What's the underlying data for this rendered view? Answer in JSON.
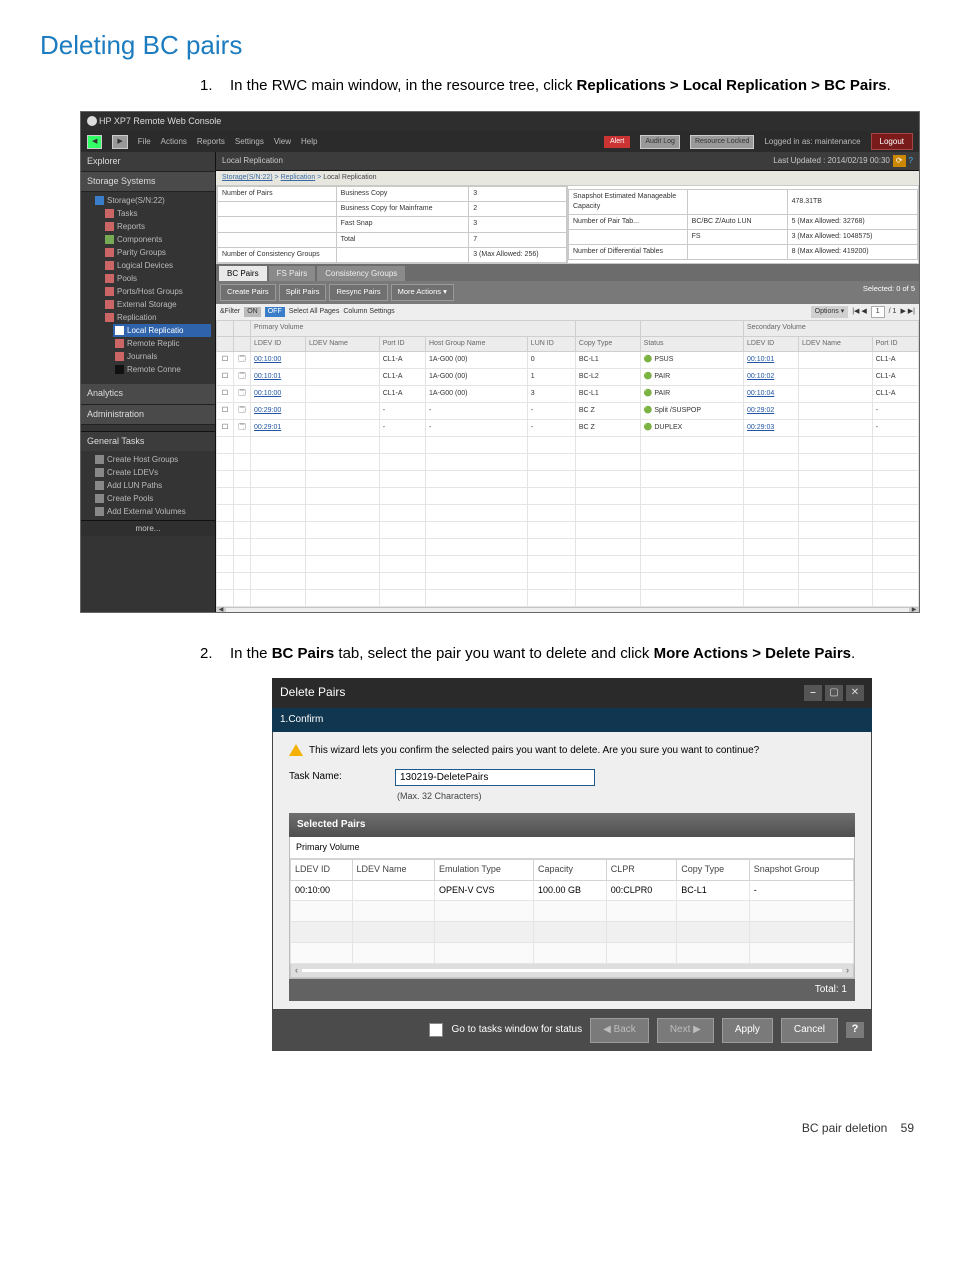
{
  "heading": "Deleting BC pairs",
  "steps": {
    "s1_pre": "In the RWC main window, in the resource tree, click ",
    "s1_strong": "Replications > Local Replication > BC Pairs",
    "s1_post": ".",
    "s2_pre": "In the ",
    "s2_strong1": "BC Pairs",
    "s2_mid": " tab, select the pair you want to delete and click ",
    "s2_strong2": "More Actions > Delete Pairs",
    "s2_post": "."
  },
  "s1": {
    "title": "HP XP7 Remote Web Console",
    "menu": [
      "File",
      "Actions",
      "Reports",
      "Settings",
      "View",
      "Help"
    ],
    "alert": "Alert",
    "auditbtn": [
      "Audit Log",
      "Resource Locked"
    ],
    "loggedin": "Logged in as: maintenance",
    "logout": "Logout",
    "explorer": "Explorer",
    "storage": "Storage Systems",
    "right_title": "Local Replication",
    "updated": "Last Updated : 2014/02/19 00:30",
    "tree": [
      {
        "lbl": "Storage(S/N:22)",
        "cls": "i1",
        "ic": "#3a7dc9"
      },
      {
        "lbl": "Tasks",
        "cls": "i2",
        "ic": "#c66"
      },
      {
        "lbl": "Reports",
        "cls": "i2",
        "ic": "#c66"
      },
      {
        "lbl": "Components",
        "cls": "i2",
        "ic": "#7a5"
      },
      {
        "lbl": "Parity Groups",
        "cls": "i2",
        "ic": "#c66"
      },
      {
        "lbl": "Logical Devices",
        "cls": "i2",
        "ic": "#c66"
      },
      {
        "lbl": "Pools",
        "cls": "i2",
        "ic": "#c66"
      },
      {
        "lbl": "Ports/Host Groups",
        "cls": "i2",
        "ic": "#c66"
      },
      {
        "lbl": "External Storage",
        "cls": "i2",
        "ic": "#c66"
      },
      {
        "lbl": "Replication",
        "cls": "i2",
        "ic": "#c66"
      },
      {
        "lbl": "Local Replicatio",
        "cls": "i3 sel",
        "ic": "#fff"
      },
      {
        "lbl": "Remote Replic",
        "cls": "i3",
        "ic": "#c66"
      },
      {
        "lbl": "Journals",
        "cls": "i3",
        "ic": "#c66"
      },
      {
        "lbl": "Remote Conne",
        "cls": "i3",
        "ic": "#111"
      }
    ],
    "sections": [
      "Analytics",
      "Administration"
    ],
    "crumb": [
      "Storage(S/N:22)",
      "Replication",
      "Local Replication"
    ],
    "summary_left": [
      [
        "Number of Pairs",
        "Business Copy",
        "3"
      ],
      [
        "",
        "Business Copy for Mainframe",
        "2"
      ],
      [
        "",
        "Fast Snap",
        "3"
      ],
      [
        "",
        "Total",
        "7"
      ],
      [
        "Number of Consistency Groups",
        "",
        "3 (Max Allowed: 256)"
      ]
    ],
    "summary_right": [
      [
        "Snapshot Estimated Manageable Capacity",
        "",
        "478.31TB"
      ],
      [
        "Number of Pair Tab...",
        "BC/BC Z/Auto LUN",
        "5 (Max Allowed: 32768)"
      ],
      [
        "",
        "FS",
        "3 (Max Allowed: 1048575)"
      ],
      [
        "Number of Differential Tables",
        "",
        "8 (Max Allowed: 419200)"
      ]
    ],
    "tabs": [
      "BC Pairs",
      "FS Pairs",
      "Consistency Groups"
    ],
    "toolbar": [
      "Create Pairs",
      "Split Pairs",
      "Resync Pairs",
      "More Actions"
    ],
    "selected": "Selected: 0  of 5",
    "filter": [
      "&Filter",
      "ON",
      "OFF",
      "Select All Pages",
      "Column Settings"
    ],
    "options": "Options",
    "page": "1",
    "pagetot": "/ 1",
    "cols1": [
      "",
      "",
      "LDEV ID",
      "LDEV Name",
      "Port ID",
      "Host Group Name",
      "LUN ID",
      "Copy Type",
      "Status",
      "LDEV ID",
      "LDEV Name",
      "Port ID"
    ],
    "primary": "Primary Volume",
    "secondary": "Secondary Volume",
    "rows": [
      {
        "l": "00:10:00",
        "p": "CL1-A",
        "hg": "1A-G00 (00)",
        "lun": "0",
        "ct": "BC-L1",
        "st": "PSUS",
        "r": "00:10:01",
        "rp": "CL1-A"
      },
      {
        "l": "00:10:01",
        "p": "CL1-A",
        "hg": "1A-G00 (00)",
        "lun": "1",
        "ct": "BC-L2",
        "st": "PAIR",
        "r": "00:10:02",
        "rp": "CL1-A"
      },
      {
        "l": "00:10:00",
        "p": "CL1-A",
        "hg": "1A-G00 (00)",
        "lun": "3",
        "ct": "BC-L1",
        "st": "PAIR",
        "r": "00:10:04",
        "rp": "CL1-A"
      },
      {
        "l": "00:29:00",
        "p": "-",
        "hg": "-",
        "lun": "-",
        "ct": "BC Z",
        "st": "Split /SUSPOP",
        "r": "00:29:02",
        "rp": "-"
      },
      {
        "l": "00:29:01",
        "p": "-",
        "hg": "-",
        "lun": "-",
        "ct": "BC Z",
        "st": "DUPLEX",
        "r": "00:29:03",
        "rp": "-"
      }
    ],
    "gen_header": "General Tasks",
    "gen_items": [
      "Create Host Groups",
      "Create LDEVs",
      "Add LUN Paths",
      "Create Pools",
      "Add External Volumes"
    ],
    "more": "more..."
  },
  "s2": {
    "title": "Delete Pairs",
    "step": "1.Confirm",
    "warn": "This wizard lets you confirm the selected pairs you want to delete. Are you sure you want to continue?",
    "task_label": "Task Name:",
    "task_value": "130219-DeletePairs",
    "task_hint": "(Max. 32 Characters)",
    "tbl_hdr": "Selected Pairs",
    "prime": "Primary Volume",
    "cols": [
      "LDEV ID",
      "LDEV Name",
      "Emulation Type",
      "Capacity",
      "CLPR",
      "Copy Type",
      "Snapshot Group"
    ],
    "row": [
      "00:10:00",
      "",
      "OPEN-V CVS",
      "100.00 GB",
      "00:CLPR0",
      "BC-L1",
      "-"
    ],
    "total": "Total: 1",
    "gocheck": "Go to tasks window for status",
    "back": "◀ Back",
    "next": "Next ▶",
    "apply": "Apply",
    "cancel": "Cancel"
  },
  "footer": {
    "label": "BC pair deletion",
    "page": "59"
  }
}
